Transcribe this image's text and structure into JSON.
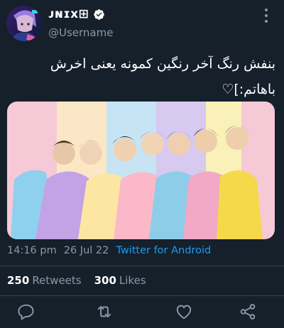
{
  "user": {
    "display_name": "ᴊɴɪx⊞",
    "handle": "@Username",
    "verified": true
  },
  "tweet": {
    "text_line1": "بنفش رنگ آخر رنگین کمونه یعنی اخرش",
    "text_line2": "باهاتم:]♡",
    "time": "14:16 pm",
    "date": "26 Jul 22",
    "source": "Twitter for Android"
  },
  "stats": {
    "retweets_count": "250",
    "retweets_label": "Retweets",
    "likes_count": "300",
    "likes_label": "Likes"
  },
  "icons": {
    "more": "more-vertical-icon",
    "reply": "reply-icon",
    "retweet": "retweet-icon",
    "like": "heart-icon",
    "share": "share-icon"
  },
  "colors": {
    "background": "#15202b",
    "muted": "#8b98a5",
    "link": "#1d9bf0",
    "verified": "#ffffff"
  }
}
